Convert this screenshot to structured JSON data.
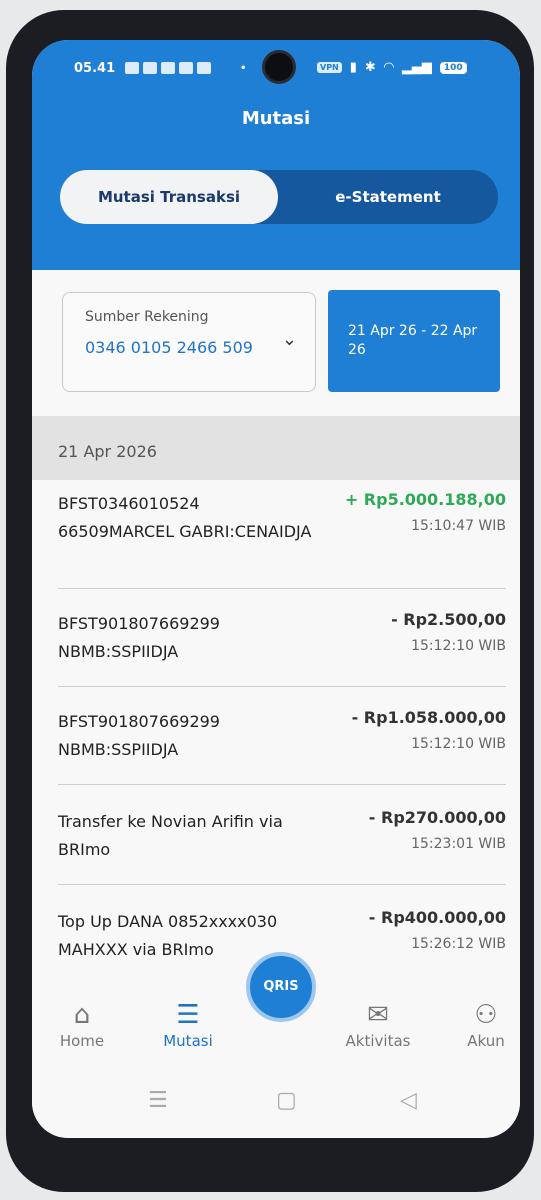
{
  "status_bar": {
    "time": "05.41",
    "vpn": "VPN",
    "battery": "100"
  },
  "header": {
    "title": "Mutasi",
    "tabs": [
      {
        "label": "Mutasi Transaksi",
        "active": true
      },
      {
        "label": "e-Statement",
        "active": false
      }
    ]
  },
  "filter": {
    "source_label": "Sumber Rekening",
    "account_number": "0346 0105 2466 509",
    "date_range": "21 Apr 26 - 22 Apr 26"
  },
  "date_group": "21 Apr 2026",
  "transactions": [
    {
      "desc": "BFST0346010524 66509MARCEL GABRI:CENAIDJA",
      "amount": "+ Rp5.000.188,00",
      "time": "15:10:47 WIB",
      "type": "credit"
    },
    {
      "desc": "BFST901807669299 NBMB:SSPIIDJA",
      "amount": "- Rp2.500,00",
      "time": "15:12:10 WIB",
      "type": "debit"
    },
    {
      "desc": "BFST901807669299 NBMB:SSPIIDJA",
      "amount": "- Rp1.058.000,00",
      "time": "15:12:10 WIB",
      "type": "debit"
    },
    {
      "desc": "Transfer ke Novian Arifin via BRImo",
      "amount": "- Rp270.000,00",
      "time": "15:23:01 WIB",
      "type": "debit"
    },
    {
      "desc": "Top Up DANA 0852xxxx030 MAHXXX via BRImo",
      "amount": "- Rp400.000,00",
      "time": "15:26:12 WIB",
      "type": "debit"
    }
  ],
  "bottom_nav": {
    "items": [
      {
        "label": "Home",
        "icon": "home-icon"
      },
      {
        "label": "Mutasi",
        "icon": "list-icon",
        "active": true
      },
      {
        "label": "Aktivitas",
        "icon": "mail-icon"
      },
      {
        "label": "Akun",
        "icon": "user-icon"
      }
    ],
    "qris_label": "QRIS"
  },
  "colors": {
    "primary": "#1f7fd4",
    "credit": "#2eaa55"
  }
}
